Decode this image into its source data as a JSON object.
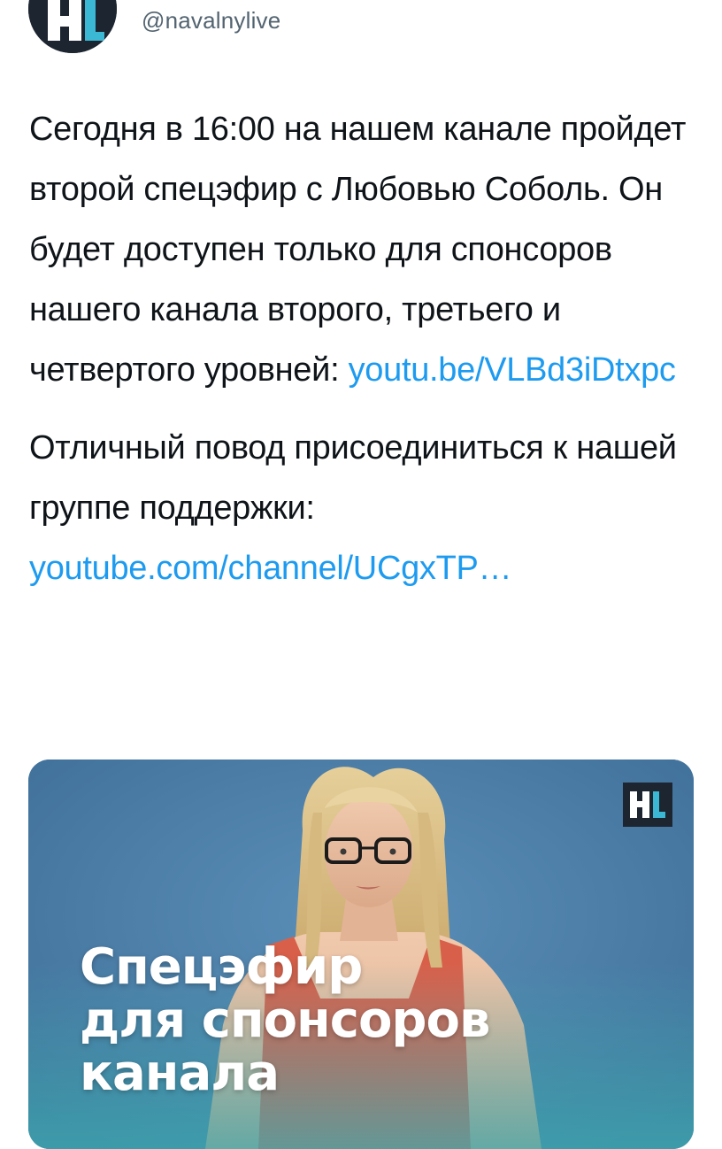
{
  "author": {
    "handle": "@navalnylive",
    "avatar_logo": "NL"
  },
  "tweet": {
    "paragraph1_text": "Сегодня в 16:00 на нашем канале пройдет второй спецэфир с Любовью Соболь. Он будет доступен только для спонсоров нашего канала второго, третьего и четвертого уровней: ",
    "paragraph1_link": "youtu.be/VLBd3iDtxpc",
    "paragraph2_text": "Отличный повод присоединиться к нашей группе поддержки: ",
    "paragraph2_link": "youtube.com/channel/UCgxTP…"
  },
  "media": {
    "logo": "NL",
    "overlay_line1": "Спецэфир",
    "overlay_line2": "для спонсоров",
    "overlay_line3": "канала"
  },
  "colors": {
    "link": "#1d9bf0",
    "handle": "#536471",
    "text": "#0f1419",
    "media_background": "#5489b0"
  }
}
